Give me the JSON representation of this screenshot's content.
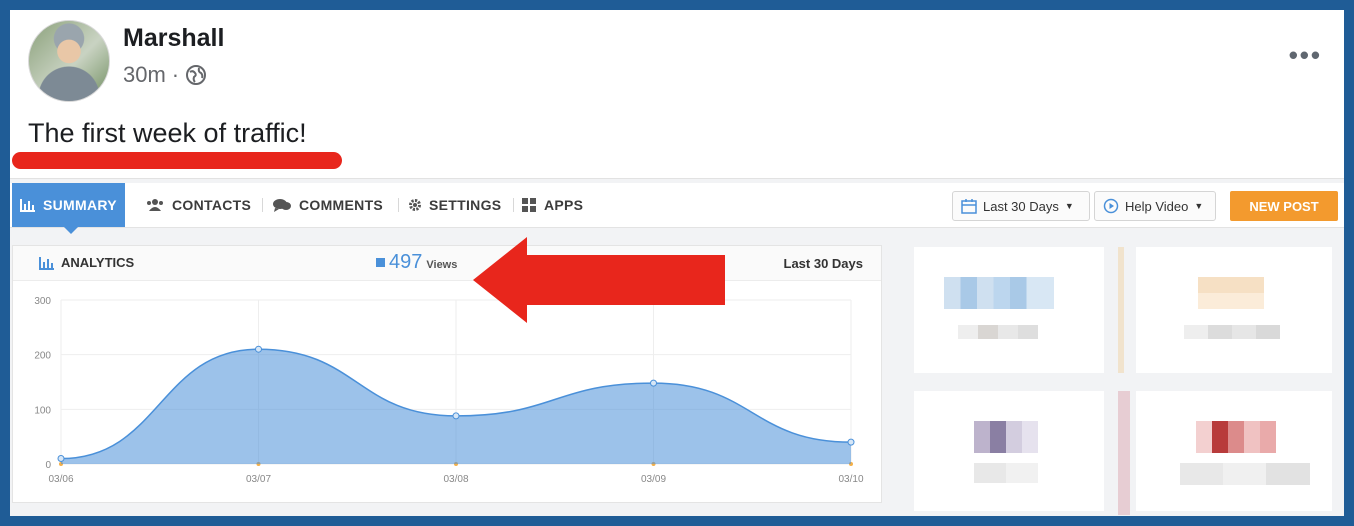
{
  "post": {
    "author": "Marshall",
    "time": "30m",
    "separator": "·",
    "audience_icon": "globe-icon",
    "more_label": "•••",
    "text": "The first week of traffic!"
  },
  "app": {
    "tabs": [
      {
        "label": "SUMMARY",
        "icon": "bar-chart-icon",
        "active": true
      },
      {
        "label": "CONTACTS",
        "icon": "users-icon",
        "active": false
      },
      {
        "label": "COMMENTS",
        "icon": "comments-icon",
        "active": false
      },
      {
        "label": "SETTINGS",
        "icon": "gear-icon",
        "active": false
      },
      {
        "label": "APPS",
        "icon": "apps-icon",
        "active": false
      }
    ],
    "date_range": "Last 30 Days",
    "help_video": "Help Video",
    "new_post": "NEW POST"
  },
  "analytics": {
    "title": "ANALYTICS",
    "views_count": "497",
    "views_label": "Views",
    "range_label": "Last 30 Days"
  },
  "chart_data": {
    "type": "area",
    "x": [
      "03/06",
      "03/07",
      "03/08",
      "03/09",
      "03/10"
    ],
    "series": [
      {
        "values": [
          10,
          210,
          88,
          148,
          40
        ]
      }
    ],
    "yticks": [
      0,
      100,
      200,
      300
    ],
    "ylim": [
      0,
      300
    ],
    "grid": true,
    "color": "#4a90d9"
  },
  "colors": {
    "accent": "#4a90d9",
    "new_post": "#f39a2e",
    "annotation": "#e8261c",
    "frame": "#1f5c96"
  }
}
